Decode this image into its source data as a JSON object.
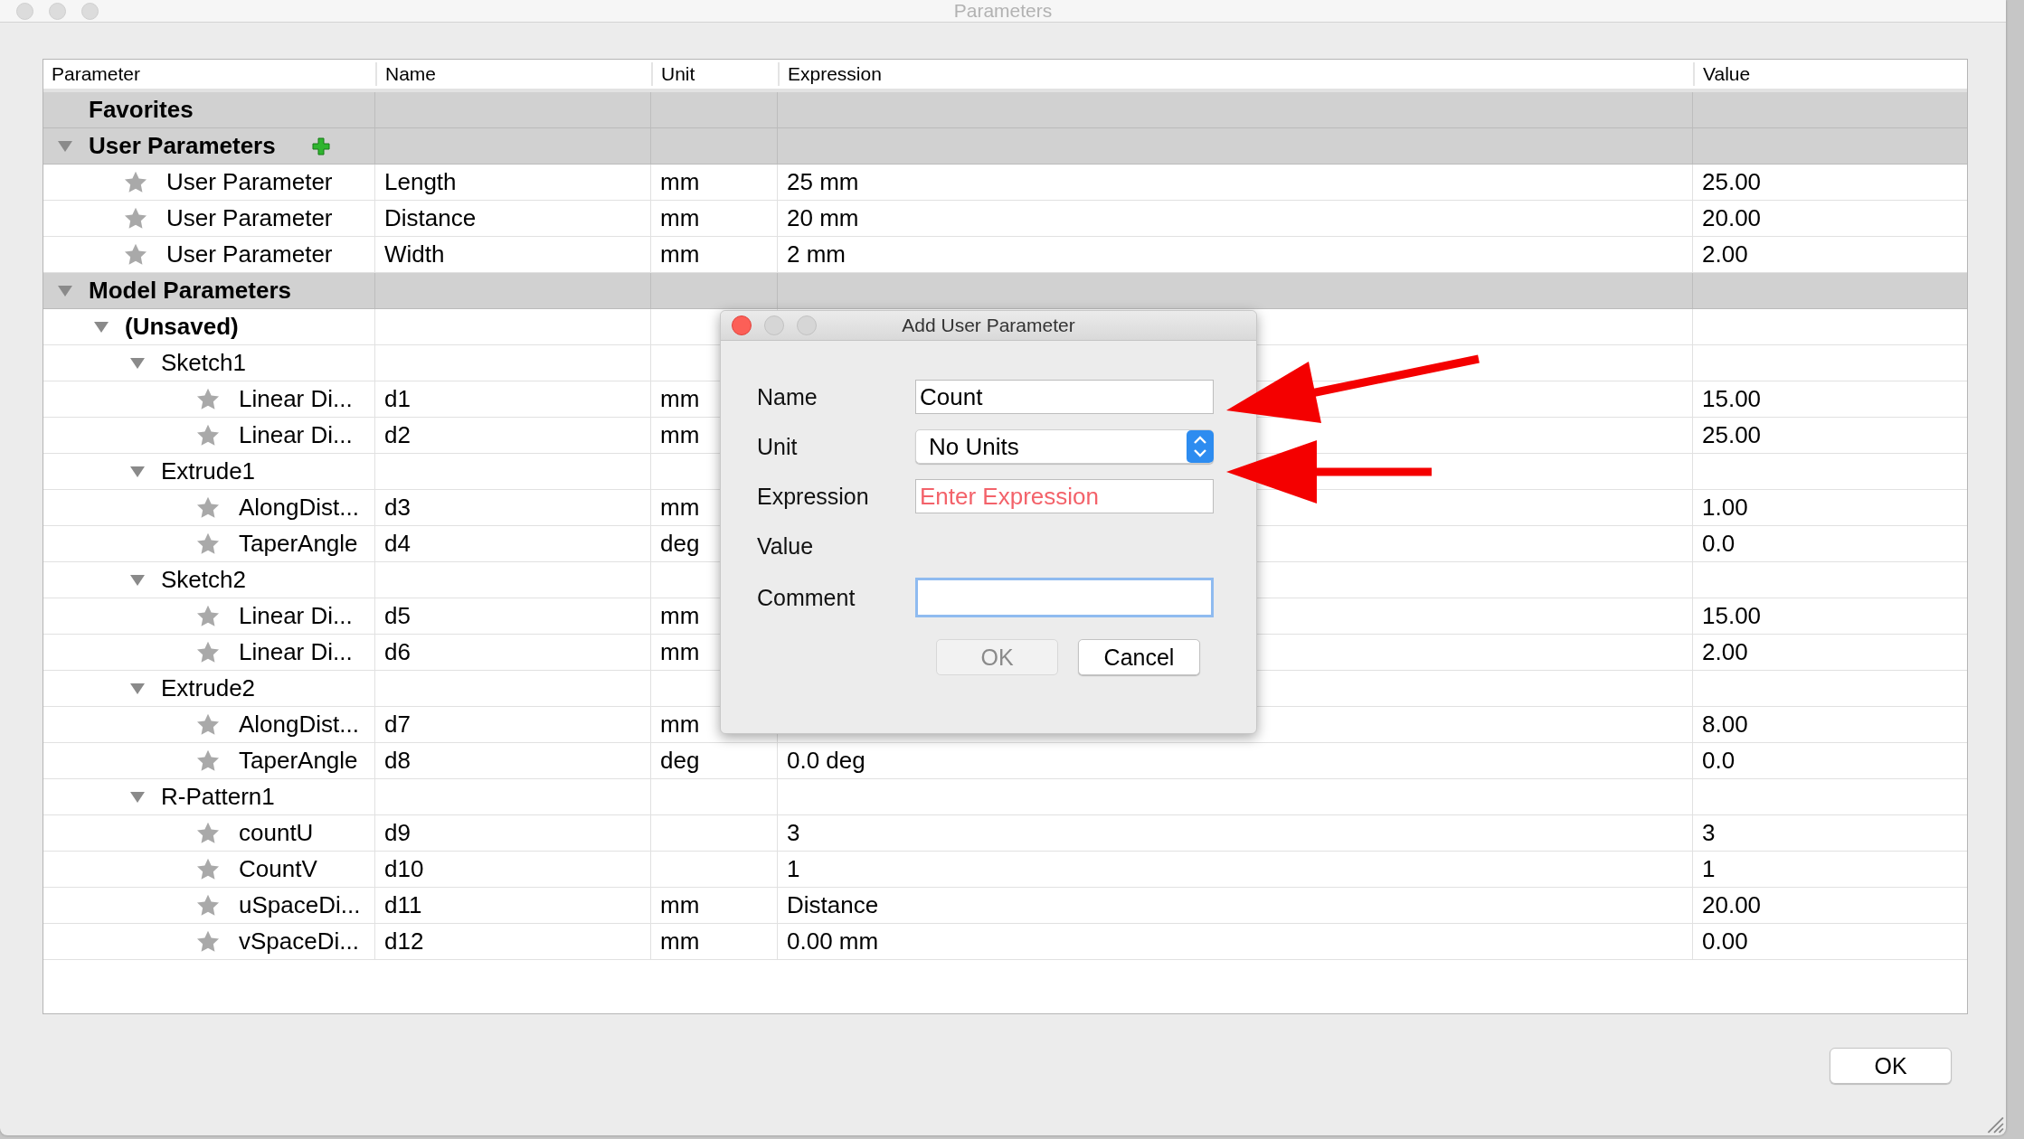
{
  "window": {
    "title": "Parameters"
  },
  "table": {
    "columns": [
      "Parameter",
      "Name",
      "Unit",
      "Expression",
      "Value"
    ],
    "rows": [
      {
        "kind": "section",
        "label": "Favorites",
        "can_add": false
      },
      {
        "kind": "section",
        "label": "User Parameters",
        "can_add": true,
        "expanded": true,
        "children": [
          {
            "kind": "param",
            "label": "User Parameter",
            "name": "Length",
            "unit": "mm",
            "expression": "25 mm",
            "value": "25.00"
          },
          {
            "kind": "param",
            "label": "User Parameter",
            "name": "Distance",
            "unit": "mm",
            "expression": "20 mm",
            "value": "20.00"
          },
          {
            "kind": "param",
            "label": "User Parameter",
            "name": "Width",
            "unit": "mm",
            "expression": "2 mm",
            "value": "2.00"
          }
        ]
      },
      {
        "kind": "section",
        "label": "Model Parameters",
        "can_add": false,
        "expanded": true,
        "children": [
          {
            "kind": "document",
            "label": "(Unsaved)",
            "expanded": true,
            "children": [
              {
                "kind": "feature",
                "label": "Sketch1",
                "expanded": true,
                "children": [
                  {
                    "kind": "param",
                    "label": "Linear Di...",
                    "name": "d1",
                    "unit": "mm",
                    "value": "15.00"
                  },
                  {
                    "kind": "param",
                    "label": "Linear Di...",
                    "name": "d2",
                    "unit": "mm",
                    "value": "25.00"
                  }
                ]
              },
              {
                "kind": "feature",
                "label": "Extrude1",
                "expanded": true,
                "children": [
                  {
                    "kind": "param",
                    "label": "AlongDist...",
                    "name": "d3",
                    "unit": "mm",
                    "value": "1.00"
                  },
                  {
                    "kind": "param",
                    "label": "TaperAngle",
                    "name": "d4",
                    "unit": "deg",
                    "value": "0.0"
                  }
                ]
              },
              {
                "kind": "feature",
                "label": "Sketch2",
                "expanded": true,
                "children": [
                  {
                    "kind": "param",
                    "label": "Linear Di...",
                    "name": "d5",
                    "unit": "mm",
                    "value": "15.00"
                  },
                  {
                    "kind": "param",
                    "label": "Linear Di...",
                    "name": "d6",
                    "unit": "mm",
                    "value": "2.00"
                  }
                ]
              },
              {
                "kind": "feature",
                "label": "Extrude2",
                "expanded": true,
                "children": [
                  {
                    "kind": "param",
                    "label": "AlongDist...",
                    "name": "d7",
                    "unit": "mm",
                    "value": "8.00"
                  },
                  {
                    "kind": "param",
                    "label": "TaperAngle",
                    "name": "d8",
                    "unit": "deg",
                    "expression": "0.0 deg",
                    "value": "0.0"
                  }
                ]
              },
              {
                "kind": "feature",
                "label": "R-Pattern1",
                "expanded": true,
                "children": [
                  {
                    "kind": "param",
                    "label": "countU",
                    "name": "d9",
                    "expression": "3",
                    "value": "3"
                  },
                  {
                    "kind": "param",
                    "label": "CountV",
                    "name": "d10",
                    "expression": "1",
                    "value": "1"
                  },
                  {
                    "kind": "param",
                    "label": "uSpaceDi...",
                    "name": "d11",
                    "unit": "mm",
                    "expression": "Distance",
                    "value": "20.00"
                  },
                  {
                    "kind": "param",
                    "label": "vSpaceDi...",
                    "name": "d12",
                    "unit": "mm",
                    "expression": "0.00 mm",
                    "value": "0.00"
                  }
                ]
              }
            ]
          }
        ]
      }
    ]
  },
  "buttons": [
    {
      "label": "OK"
    }
  ],
  "dialog": {
    "title": "Add User Parameter",
    "fields": [
      {
        "kind": "text",
        "label": "Name",
        "value": "Count",
        "invalid": false,
        "focused": false
      },
      {
        "kind": "select",
        "label": "Unit",
        "value": "No Units"
      },
      {
        "kind": "text",
        "label": "Expression",
        "placeholder": "Enter Expression",
        "invalid": true,
        "focused": false
      },
      {
        "kind": "readout",
        "label": "Value"
      },
      {
        "kind": "text",
        "label": "Comment",
        "invalid": false,
        "focused": true
      }
    ],
    "buttons": [
      {
        "label": "OK",
        "disabled": true
      },
      {
        "label": "Cancel",
        "disabled": false
      }
    ]
  }
}
